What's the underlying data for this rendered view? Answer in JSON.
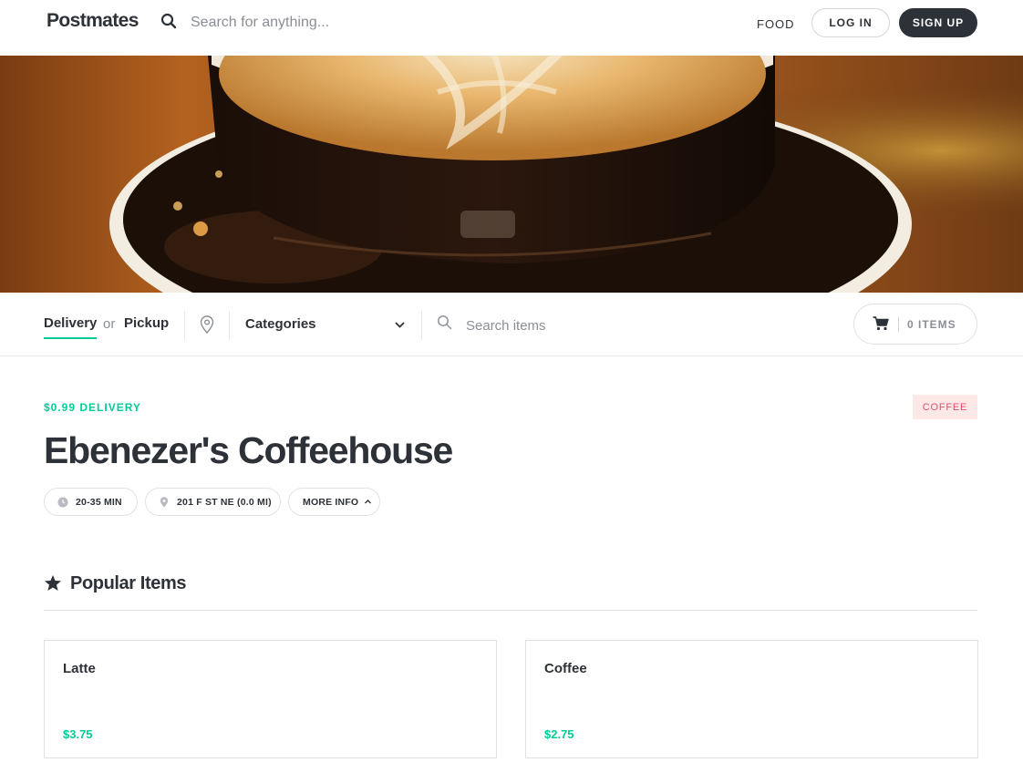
{
  "header": {
    "logo": "Postmates",
    "search_placeholder": "Search for anything...",
    "nav_food": "FOOD",
    "login_label": "LOG IN",
    "signup_label": "SIGN UP",
    "search_icon": "search-icon"
  },
  "hero": {
    "image": "coffee-latte-art-photo"
  },
  "toolbar": {
    "delivery_label": "Delivery",
    "or_label": "or",
    "pickup_label": "Pickup",
    "location_icon": "location-pin-icon",
    "categories_label": "Categories",
    "search_placeholder": "Search items",
    "cart_label": "0 ITEMS"
  },
  "store": {
    "delivery_fee": "$0.99 DELIVERY",
    "category_badge": "COFFEE",
    "name": "Ebenezer's Coffeehouse",
    "eta": "20-35 MIN",
    "address": "201 F ST NE (0.0 MI)",
    "more_info": "MORE INFO"
  },
  "popular": {
    "title": "Popular Items",
    "items": [
      {
        "name": "Latte",
        "price": "$3.75"
      },
      {
        "name": "Coffee",
        "price": "$2.75"
      }
    ]
  },
  "colors": {
    "accent": "#00cc99",
    "dark": "#2d3138",
    "badge_bg": "#fde8e8",
    "badge_text": "#e0506a"
  }
}
